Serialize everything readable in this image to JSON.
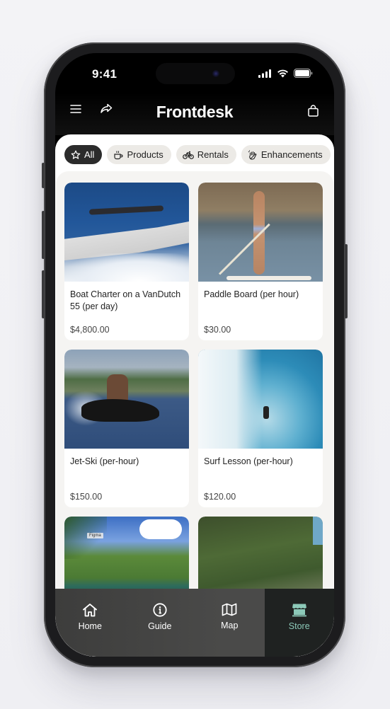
{
  "status_bar": {
    "time": "9:41"
  },
  "app_bar": {
    "title": "Frontdesk",
    "menu_icon": "hamburger-menu-icon",
    "share_icon": "share-forward-icon",
    "cart_icon": "shopping-bag-icon"
  },
  "filters": [
    {
      "label": "All",
      "icon": "star-icon",
      "active": true
    },
    {
      "label": "Products",
      "icon": "coffee-cup-icon",
      "active": false
    },
    {
      "label": "Rentals",
      "icon": "bicycle-icon",
      "active": false
    },
    {
      "label": "Enhancements",
      "icon": "hand-sparkle-icon",
      "active": false
    }
  ],
  "products": [
    {
      "name": "Boat Charter on a VanDutch 55 (per day)",
      "price": "$4,800.00",
      "image": "speedboat-photo"
    },
    {
      "name": "Paddle Board (per hour)",
      "price": "$30.00",
      "image": "paddle-board-photo"
    },
    {
      "name": "Jet-Ski (per-hour)",
      "price": "$150.00",
      "image": "jet-ski-photo"
    },
    {
      "name": "Surf Lesson (per-hour)",
      "price": "$120.00",
      "image": "surf-wave-photo"
    },
    {
      "name": "",
      "price": "",
      "image": "tennis-court-photo",
      "image_tag": "Figma"
    },
    {
      "name": "",
      "price": "",
      "image": "coastal-cove-photo"
    }
  ],
  "tab_bar": {
    "active_color": "#8cc9b8",
    "tabs": [
      {
        "label": "Home",
        "icon": "home-icon",
        "active": false
      },
      {
        "label": "Guide",
        "icon": "info-circle-icon",
        "active": false
      },
      {
        "label": "Map",
        "icon": "map-icon",
        "active": false
      },
      {
        "label": "Store",
        "icon": "storefront-icon",
        "active": true
      }
    ]
  }
}
